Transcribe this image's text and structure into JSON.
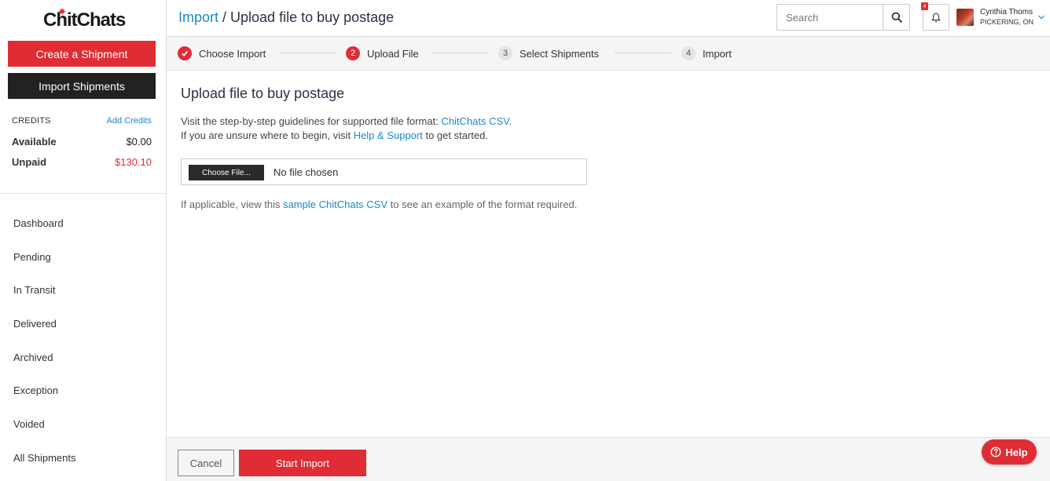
{
  "brand": {
    "name": "ChitChats",
    "accent_color": "#e02d35",
    "link_color": "#1e88c8"
  },
  "sidebar": {
    "create_label": "Create a Shipment",
    "import_label": "Import Shipments",
    "credits": {
      "label": "CREDITS",
      "add_label": "Add Credits",
      "available_label": "Available",
      "available_value": "$0.00",
      "unpaid_label": "Unpaid",
      "unpaid_value": "$130.10"
    },
    "nav": [
      {
        "label": "Dashboard"
      },
      {
        "label": "Pending"
      },
      {
        "label": "In Transit"
      },
      {
        "label": "Delivered"
      },
      {
        "label": "Archived"
      },
      {
        "label": "Exception"
      },
      {
        "label": "Voided"
      },
      {
        "label": "All Shipments"
      }
    ]
  },
  "header": {
    "breadcrumb_link": "Import",
    "breadcrumb_sep": " / ",
    "title": "Upload file to buy postage",
    "search_placeholder": "Search",
    "notification_count": "4",
    "user_name": "Cynthia Thoms",
    "user_location": "PICKERING, ON"
  },
  "stepper": {
    "steps": [
      {
        "number": "",
        "label": "Choose Import",
        "state": "done"
      },
      {
        "number": "2",
        "label": "Upload File",
        "state": "active"
      },
      {
        "number": "3",
        "label": "Select Shipments",
        "state": "pending"
      },
      {
        "number": "4",
        "label": "Import",
        "state": "pending"
      }
    ]
  },
  "main": {
    "title": "Upload file to buy postage",
    "line1_text": "Visit the step-by-step guidelines for supported file format: ",
    "line1_link": "ChitChats CSV",
    "line1_end": ".",
    "line2_text": "If you are unsure where to begin, visit ",
    "line2_link": "Help & Support",
    "line2_end": " to get started.",
    "file_button": "Choose File...",
    "file_status": "No file chosen",
    "line3_text": "If applicable, view this ",
    "line3_link": "sample ChitChats CSV",
    "line3_end": " to see an example of the format required."
  },
  "footer": {
    "cancel_label": "Cancel",
    "start_label": "Start Import"
  },
  "help": {
    "label": "Help"
  }
}
